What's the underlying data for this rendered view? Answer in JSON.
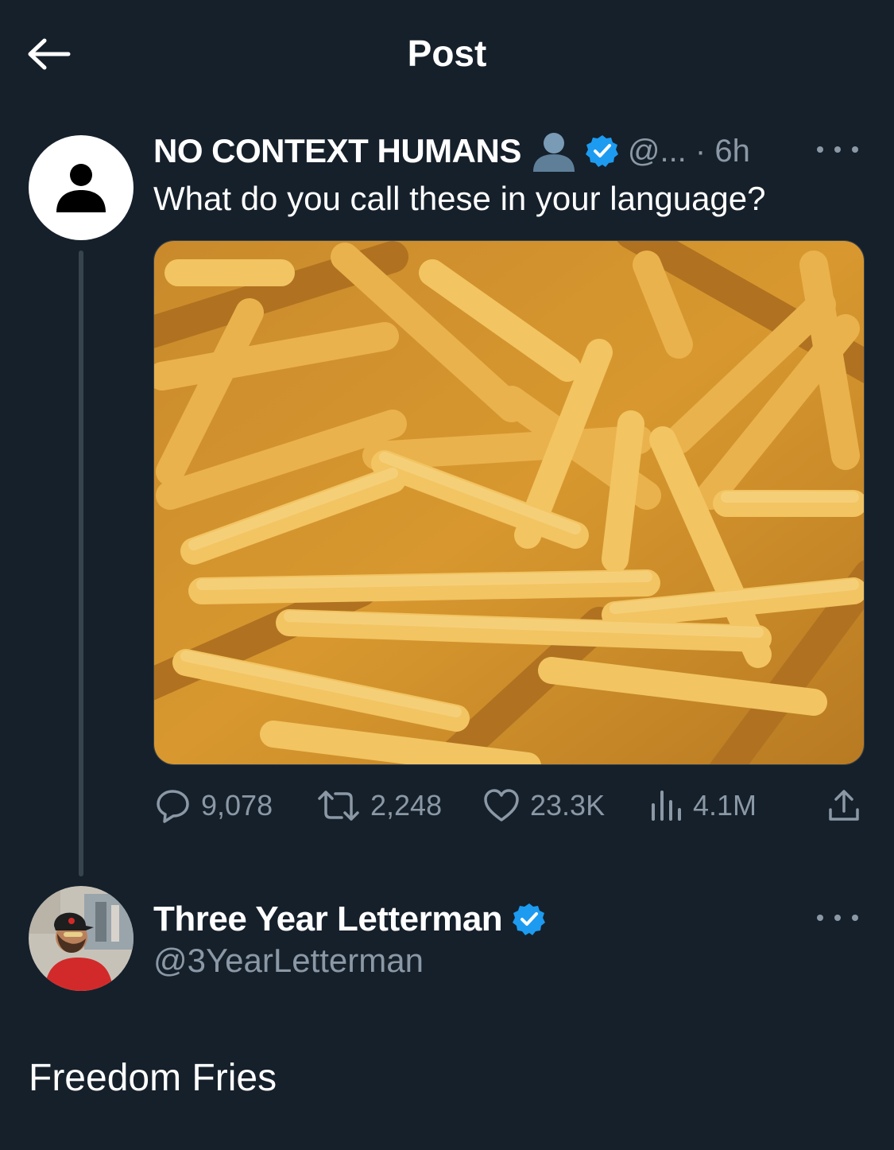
{
  "header": {
    "title": "Post"
  },
  "original_post": {
    "display_name": "NO CONTEXT HUMANS",
    "handle_time": "@... · 6h",
    "text": "What do you call these in your language?",
    "stats": {
      "replies": "9,078",
      "reposts": "2,248",
      "likes": "23.3K",
      "views": "4.1M"
    }
  },
  "reply": {
    "display_name": "Three Year Letterman",
    "handle": "@3YearLetterman",
    "text": "Freedom Fries"
  },
  "colors": {
    "background": "#15202b",
    "text_primary": "#ffffff",
    "text_secondary": "#8b98a5",
    "verified": "#1d9bf0",
    "thread_line": "#38444d"
  }
}
